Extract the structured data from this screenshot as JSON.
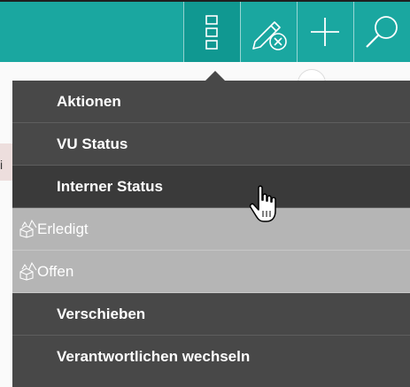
{
  "toolbar": {
    "buttons": [
      {
        "icon": "grid-menu-icon",
        "active": true
      },
      {
        "icon": "pencil-cancel-icon"
      },
      {
        "icon": "plus-icon"
      },
      {
        "icon": "search-icon"
      }
    ],
    "color": "#1aa7a0"
  },
  "background": {
    "partial_letter": "i"
  },
  "menu": {
    "items": [
      {
        "label": "Aktionen"
      },
      {
        "label": "VU Status"
      },
      {
        "label": "Interner Status"
      },
      {
        "label": "Erledigt"
      },
      {
        "label": "Offen"
      },
      {
        "label": "Verschieben"
      },
      {
        "label": "Verantwortlichen wechseln"
      }
    ],
    "hovered_item": "Interner Status",
    "background_color": "#484848",
    "sub_item_color": "#b5b5b5"
  }
}
